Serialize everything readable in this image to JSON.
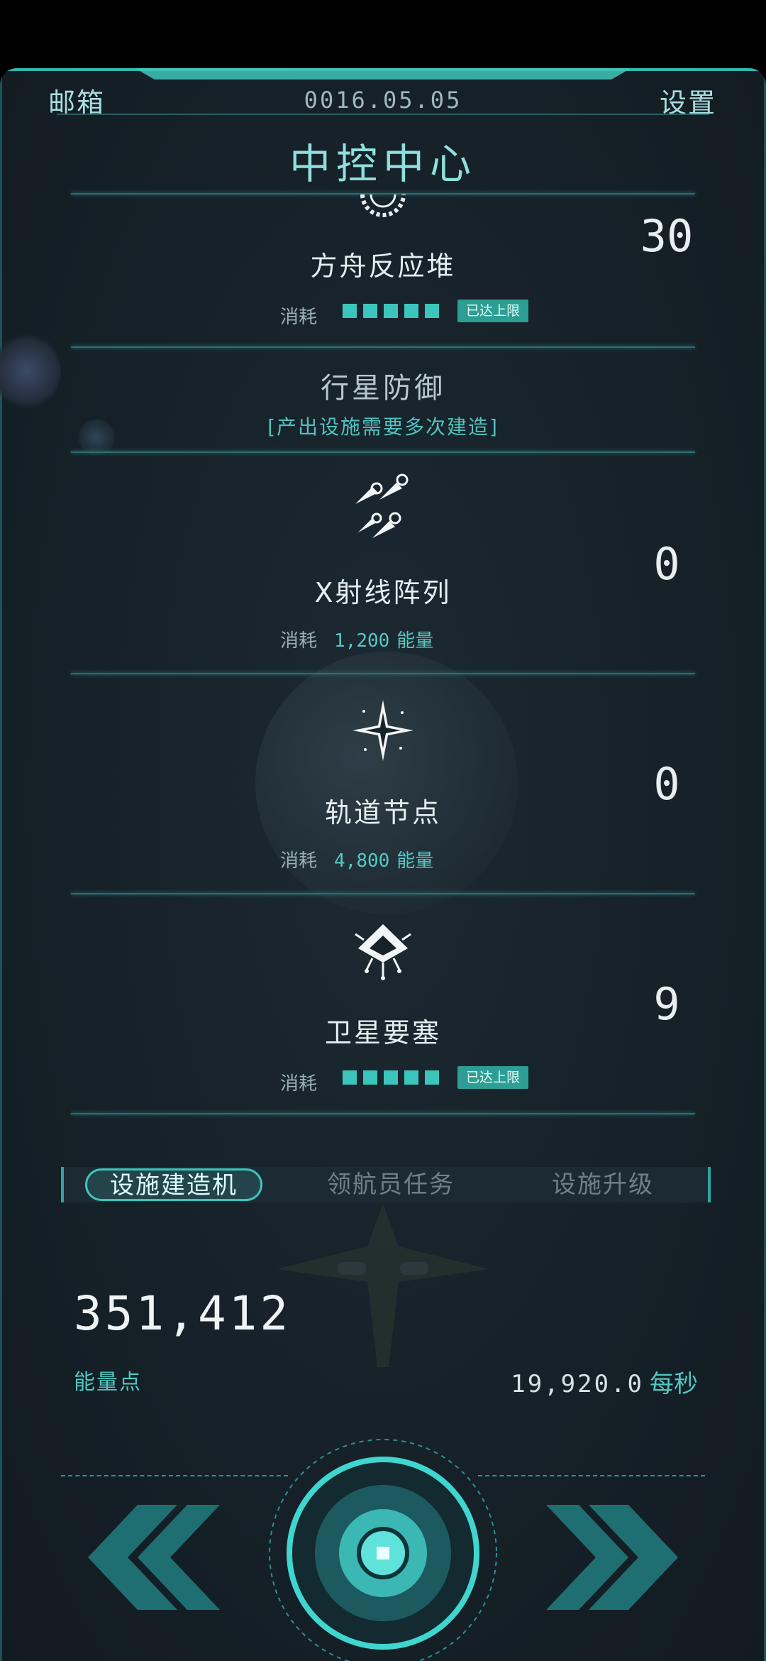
{
  "header": {
    "mailbox_label": "邮箱",
    "date": "0016.05.05",
    "settings_label": "设置",
    "title": "中控中心"
  },
  "facilities": {
    "reactor": {
      "name": "方舟反应堆",
      "count": "30",
      "cost_label": "消耗",
      "level_filled": 5,
      "level_max": 5,
      "max_badge": "已达上限"
    },
    "section": {
      "title": "行星防御",
      "subtitle": "[产出设施需要多次建造]"
    },
    "xray": {
      "name": "X射线阵列",
      "count": "0",
      "cost_label": "消耗",
      "cost_value": "1,200",
      "cost_unit": "能量"
    },
    "orbital": {
      "name": "轨道节点",
      "count": "0",
      "cost_label": "消耗",
      "cost_value": "4,800",
      "cost_unit": "能量"
    },
    "fortress": {
      "name": "卫星要塞",
      "count": "9",
      "cost_label": "消耗",
      "level_filled": 5,
      "level_max": 5,
      "max_badge": "已达上限"
    }
  },
  "tabs": [
    {
      "label": "设施建造机",
      "active": true
    },
    {
      "label": "领航员任务",
      "active": false
    },
    {
      "label": "设施升级",
      "active": false
    }
  ],
  "energy": {
    "value": "351,412",
    "label": "能量点",
    "rate_value": "19,920.0",
    "rate_unit": "每秒"
  },
  "controls": {
    "left_icon": "double-chevron-left-icon",
    "center_icon": "core-button-icon",
    "right_icon": "double-chevron-right-icon"
  },
  "colors": {
    "accent": "#3cc5bd",
    "background": "#17222a",
    "badge": "#2d9e93"
  }
}
